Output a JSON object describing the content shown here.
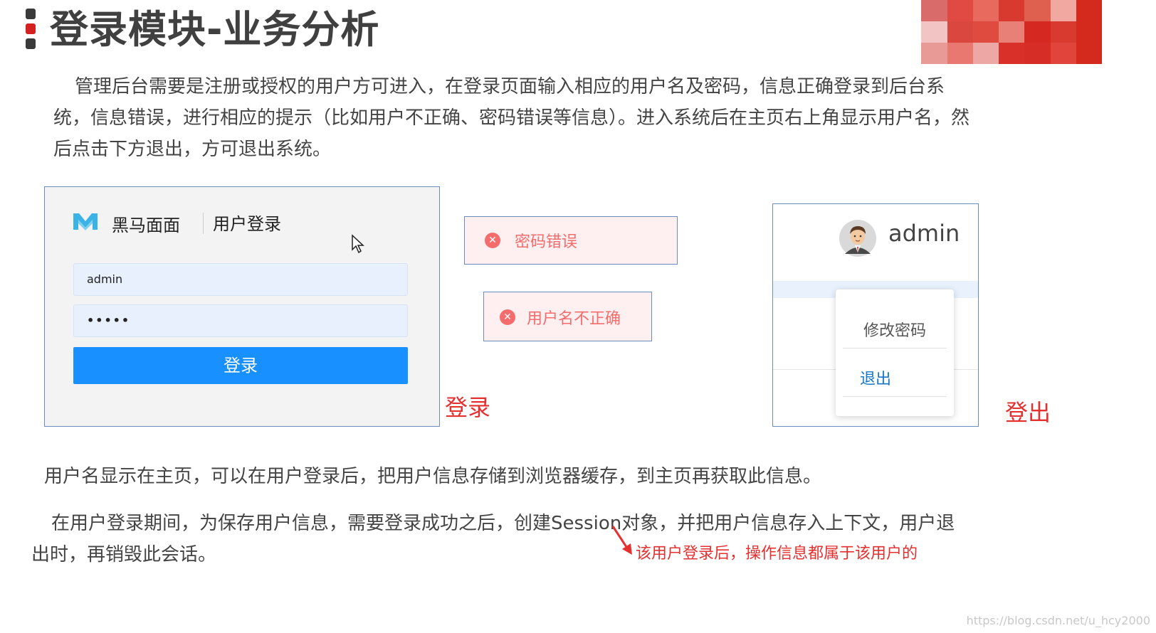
{
  "title": "登录模块-业务分析",
  "paragraph1": {
    "line1": "管理后台需要是注册或授权的用户方可进入，在登录页面输入相应的用户名及密码，信息正确登录到后台系",
    "line2": "统，信息错误，进行相应的提示（比如用户不正确、密码错误等信息）。进入系统后在主页右上角显示用户名，然",
    "line3": "后点击下方退出，方可退出系统。"
  },
  "login_panel": {
    "brand": "黑马面面",
    "subtitle": "用户登录",
    "username_value": "admin",
    "password_mask": "•••••",
    "button": "登录"
  },
  "login_label": "登录",
  "errors": {
    "password_error": "密码错误",
    "username_error": "用户名不正确"
  },
  "logout_panel": {
    "username": "admin",
    "menu_change_password": "修改密码",
    "menu_logout": "退出"
  },
  "logout_label": "登出",
  "paragraph2": "用户名显示在主页，可以在用户登录后，把用户信息存储到浏览器缓存，到主页再获取此信息。",
  "paragraph3": {
    "line1": "在用户登录期间，为保存用户信息，需要登录成功之后，创建Session对象，并把用户信息存入上下文，用户退",
    "line2": "出时，再销毁此会话。"
  },
  "annotation": "该用户登录后，操作信息都属于该用户的",
  "watermark": "https://blog.csdn.net/u_hcy2000",
  "colors": {
    "accent_red": "#e53030",
    "button_blue": "#1890ff",
    "error_red": "#f56c6c",
    "link_blue": "#1677c7"
  }
}
